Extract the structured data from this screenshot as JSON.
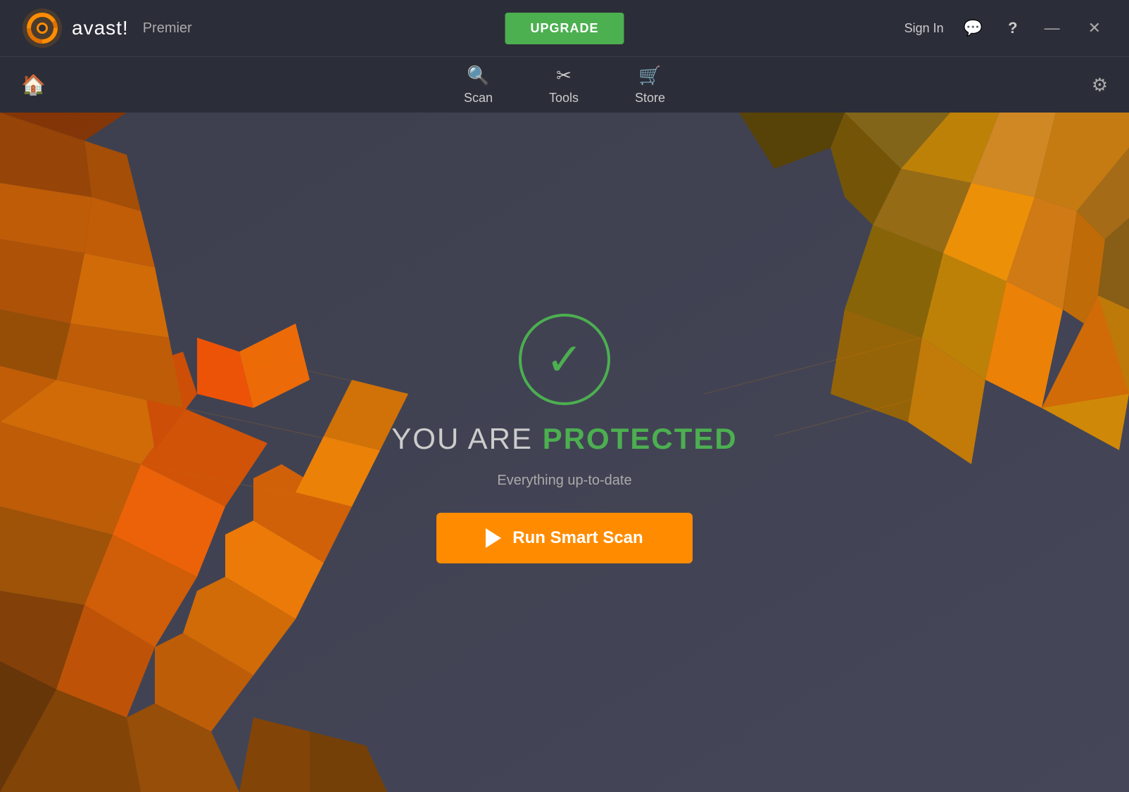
{
  "app": {
    "brand": "avast!",
    "edition": "Premier"
  },
  "header": {
    "upgrade_label": "UPGRADE",
    "sign_in_label": "Sign In",
    "home_icon": "🏠",
    "nav": [
      {
        "label": "Scan",
        "icon": "🔍"
      },
      {
        "label": "Tools",
        "icon": "✂"
      },
      {
        "label": "Store",
        "icon": "🛒"
      }
    ],
    "settings_icon": "⚙",
    "chat_icon": "💬",
    "help_icon": "?",
    "minimize_icon": "—",
    "close_icon": "✕"
  },
  "main": {
    "status_prefix": "YOU ARE ",
    "status_highlight": "PROTECTED",
    "subtitle": "Everything up-to-date",
    "scan_button": "Run Smart Scan"
  },
  "colors": {
    "green": "#4CAF50",
    "orange": "#FF8C00",
    "bg_dark": "#2b2d38",
    "bg_main": "#3d3f4e",
    "text_light": "#cccccc",
    "text_dim": "#aaaaaa"
  }
}
